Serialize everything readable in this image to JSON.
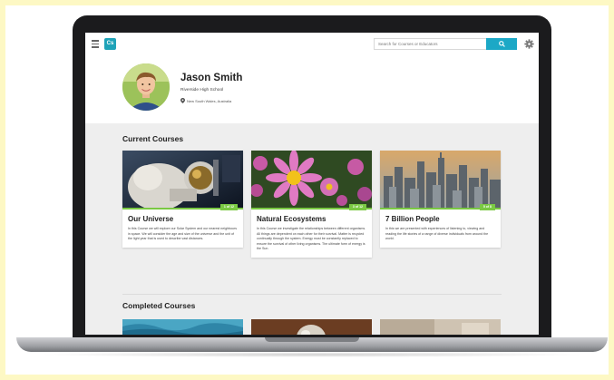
{
  "app": {
    "logo_text": "Cs"
  },
  "search": {
    "placeholder": "Search for Courses or Educators"
  },
  "profile": {
    "name": "Jason Smith",
    "school": "Riverside High School",
    "location": "New South Wales, Australia"
  },
  "current_courses": {
    "heading": "Current Courses",
    "items": [
      {
        "title": "Our Universe",
        "badge": "1 of 12",
        "description": "In this Course we will explore our Solar System and our nearest neighbours in space. We will consider the age and size of the universe and the unit of the light year that is used to describe vast distances."
      },
      {
        "title": "Natural Ecosystems",
        "badge": "3 of 12",
        "description": "In this Course we investigate the relationships between different organisms. All things are dependent on each other for their survival. Matter is recycled continually through the system. Energy must be constantly replaced to ensure the survival of other living organisms. The ultimate form of energy is the Sun."
      },
      {
        "title": "7 Billion People",
        "badge": "5 of 8",
        "description": "In this we are presented with experiences of listening to, viewing and reading the life stories of a range of diverse individuals from around the world."
      }
    ]
  },
  "completed_courses": {
    "heading": "Completed Courses"
  },
  "colors": {
    "accent": "#1ca8c6",
    "progress": "#7ac943",
    "logo": "#1fa3b8"
  }
}
